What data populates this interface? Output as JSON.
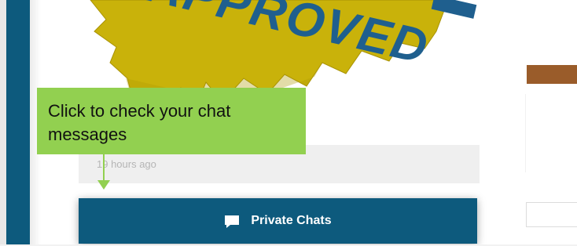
{
  "post": {
    "image_text": "APPROVED",
    "timestamp": "19 hours ago"
  },
  "chat": {
    "label": "Private Chats",
    "icon": "chat-bubble-icon"
  },
  "tooltip": {
    "text": "Click to check your chat messages"
  },
  "colors": {
    "sidebar": "#0d5a7d",
    "chat_bar": "#0d5a7d",
    "tooltip": "#92d050",
    "badge_gold": "#c9b20a",
    "badge_text": "#1f5f8e",
    "right_strip": "#9a5c2a"
  }
}
